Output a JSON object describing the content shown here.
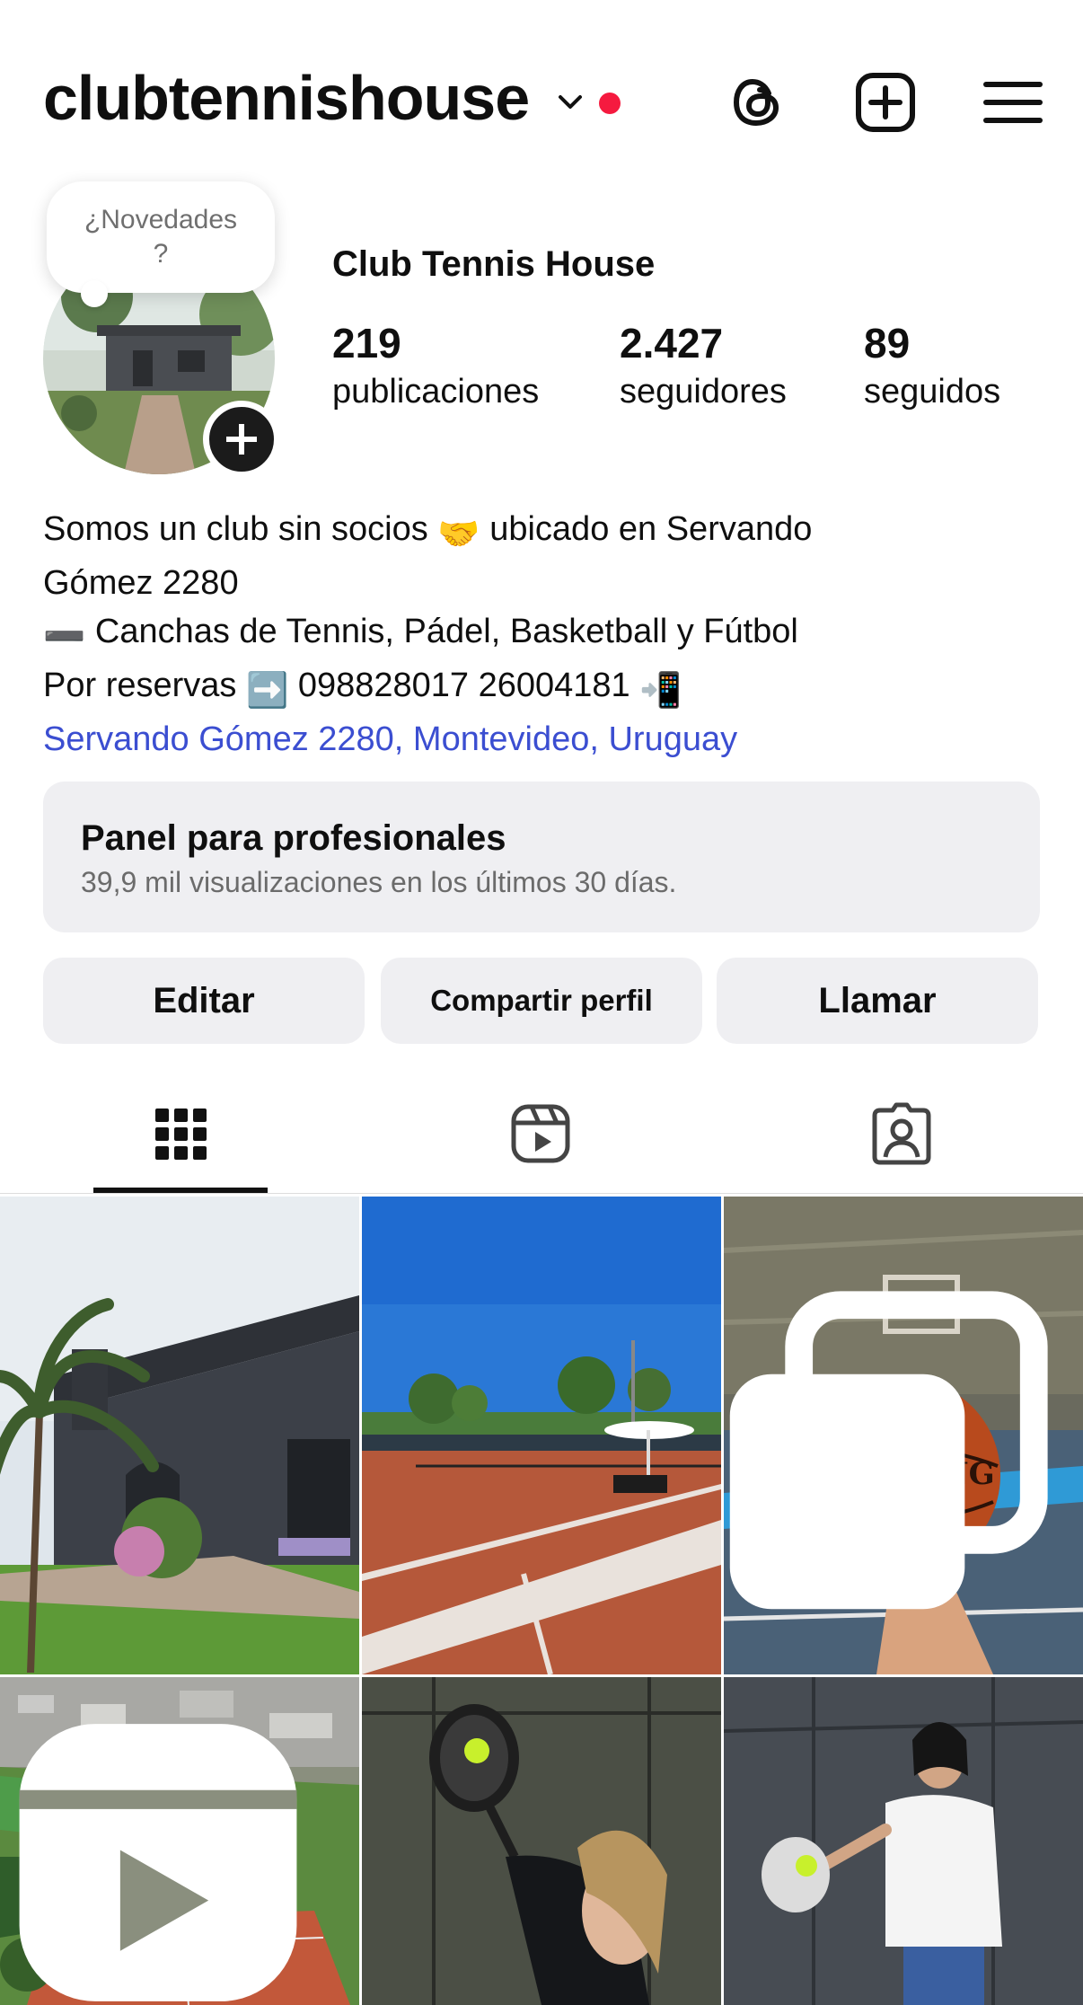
{
  "header": {
    "username": "clubtennishouse",
    "icons": [
      "chevron-down-icon",
      "notification-dot",
      "threads-icon",
      "new-post-icon",
      "menu-icon"
    ],
    "accent_dot_color": "#f51a3f"
  },
  "profile": {
    "note_bubble": "¿Novedades ?",
    "display_name": "Club Tennis House",
    "stats": [
      {
        "value": "219",
        "label": "publicaciones"
      },
      {
        "value": "2.427",
        "label": "seguidores"
      },
      {
        "value": "89",
        "label": "seguidos"
      }
    ]
  },
  "bio": {
    "line1_a": "Somos un club sin socios ",
    "line1_emoji": "🤝",
    "line1_b": " ubicado en Servando",
    "line2": "Gómez 2280",
    "line3_emoji": "➖",
    "line3": " Canchas de Tennis, Pádel, Basketball y Fútbol",
    "line4_a": "Por reservas ",
    "line4_emoji1": "➡️",
    "line4_b": " 098828017 26004181 ",
    "line4_emoji2": "📲",
    "location_link": "Servando Gómez 2280, Montevideo, Uruguay",
    "link_color": "#3b4ed1"
  },
  "panel": {
    "title": "Panel para profesionales",
    "subtitle": "39,9 mil visualizaciones en los últimos 30 días."
  },
  "buttons": {
    "edit": "Editar",
    "share": "Compartir perfil",
    "call": "Llamar"
  },
  "tabs": [
    {
      "icon": "grid-icon",
      "active": true
    },
    {
      "icon": "reels-icon",
      "active": false
    },
    {
      "icon": "tagged-icon",
      "active": false
    }
  ],
  "posts": [
    {
      "subject": "clubhouse-building",
      "badge": ""
    },
    {
      "subject": "clay-tennis-court",
      "badge": ""
    },
    {
      "subject": "spalding-basketball",
      "badge": "carousel-icon"
    },
    {
      "subject": "aerial-view-courts",
      "badge": "reel-icon"
    },
    {
      "subject": "padel-player-woman",
      "badge": ""
    },
    {
      "subject": "padel-player-woman-white",
      "badge": ""
    }
  ]
}
